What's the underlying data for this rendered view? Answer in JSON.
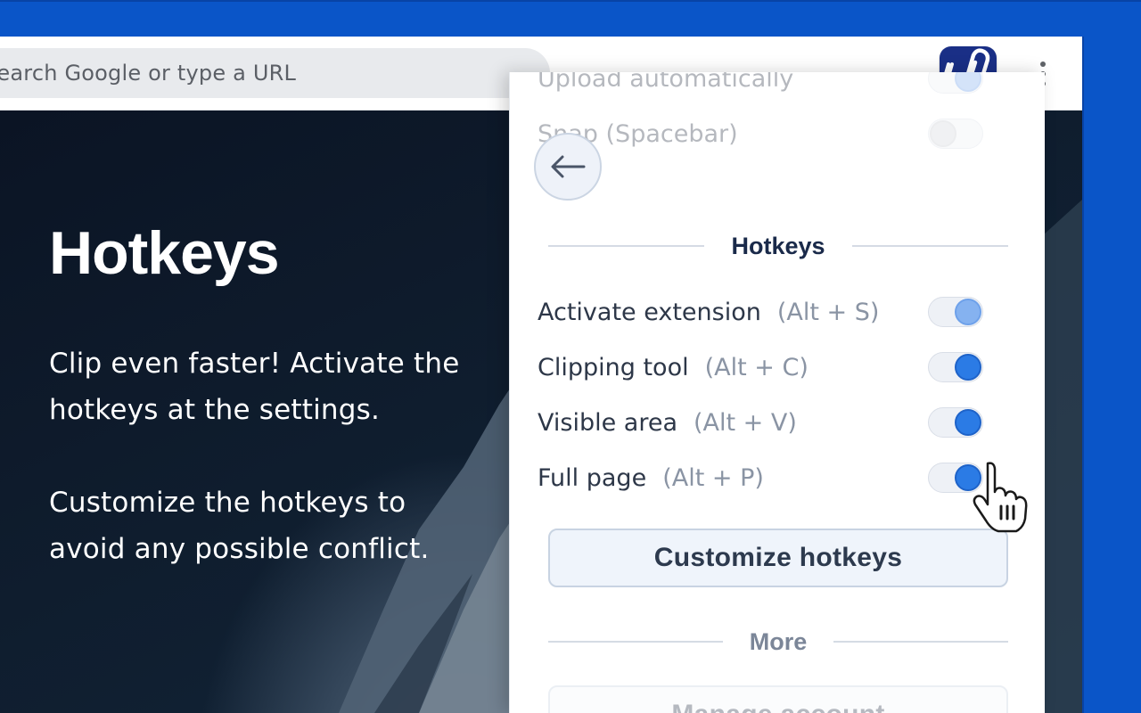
{
  "browser": {
    "omnibox_text": "Search Google or type a URL",
    "extension_icon": "clipping-extension-icon",
    "menu_icon": "kebab-menu-icon"
  },
  "hero": {
    "title": "Hotkeys",
    "paragraph1": "Clip even faster! Activate the hotkeys at the settings.",
    "paragraph2": "Customize the hotkeys to avoid any possible conflict."
  },
  "panel": {
    "back_icon": "arrow-left-icon",
    "top_rows": [
      {
        "label": "Upload automatically",
        "state": "on-light"
      },
      {
        "label": "Snap (Spacebar)",
        "state": "off"
      }
    ],
    "hotkeys_title": "Hotkeys",
    "hotkeys": [
      {
        "label": "Activate extension",
        "keys": "(Alt + S)",
        "state": "on-light"
      },
      {
        "label": "Clipping tool",
        "keys": "(Alt + C)",
        "state": "on"
      },
      {
        "label": "Visible area",
        "keys": "(Alt + V)",
        "state": "on"
      },
      {
        "label": "Full page",
        "keys": "(Alt + P)",
        "state": "on"
      }
    ],
    "customize_button": "Customize hotkeys",
    "more_title": "More",
    "manage_button": "Manage account"
  },
  "colors": {
    "accent": "#2b7be5",
    "frame": "#0a55c8",
    "ext_navy": "#1a2f86",
    "ext_orange": "#f3a31b"
  }
}
